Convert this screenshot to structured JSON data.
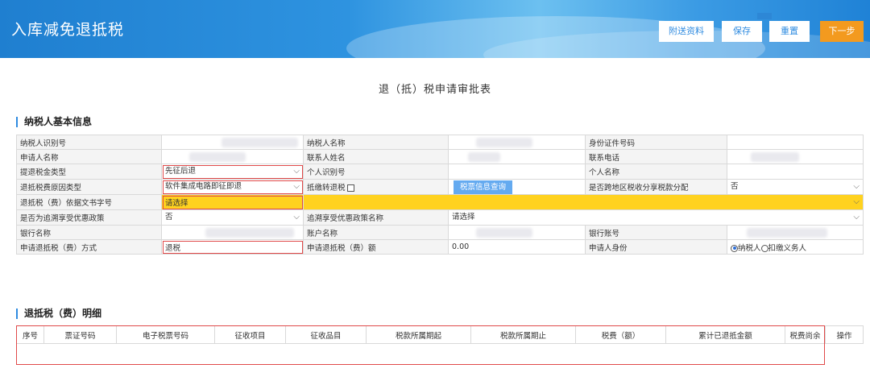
{
  "header": {
    "title": "入库减免退抵税",
    "buttons": {
      "attach": "附送资料",
      "save": "保存",
      "reset": "重置",
      "next": "下一步"
    }
  },
  "form_title": "退（抵）税申请审批表",
  "basic_section": {
    "title": "纳税人基本信息",
    "rows": [
      {
        "l1": "纳税人识别号",
        "l2": "纳税人名称",
        "l3": "身份证件号码"
      },
      {
        "l1": "申请人名称",
        "l2": "联系人姓名",
        "l3": "联系电话"
      },
      {
        "l1": "提退税金类型",
        "v1": "先征后退",
        "l2": "个人识别号",
        "l3": "个人名称"
      },
      {
        "l1": "退抵税费原因类型",
        "v1": "软件集成电路即征即退",
        "l2": "抵缴转退税",
        "button": "税票信息查询",
        "l3": "是否跨地区税收分享税款分配",
        "v3": "否"
      },
      {
        "l1": "退抵税（费）依据文书字号",
        "v1": "请选择"
      },
      {
        "l1": "是否为追溯享受优惠政策",
        "v1": "否",
        "l2": "追溯享受优惠政策名称",
        "v2": "请选择"
      },
      {
        "l1": "银行名称",
        "l2": "账户名称",
        "l3": "银行账号"
      },
      {
        "l1": "申请退抵税（费）方式",
        "v1": "退税",
        "l2": "申请退抵税（费）额",
        "v2": "0.00",
        "l3": "申请人身份",
        "r1": "纳税人",
        "r2": "扣缴义务人"
      }
    ]
  },
  "detail_section": {
    "title": "退抵税（费）明细",
    "columns": [
      "序号",
      "票证号码",
      "电子税票号码",
      "征收项目",
      "征收品目",
      "税款所属期起",
      "税款所属期止",
      "税费（额）",
      "累计已退抵金额",
      "税费尚余",
      "操作"
    ]
  }
}
